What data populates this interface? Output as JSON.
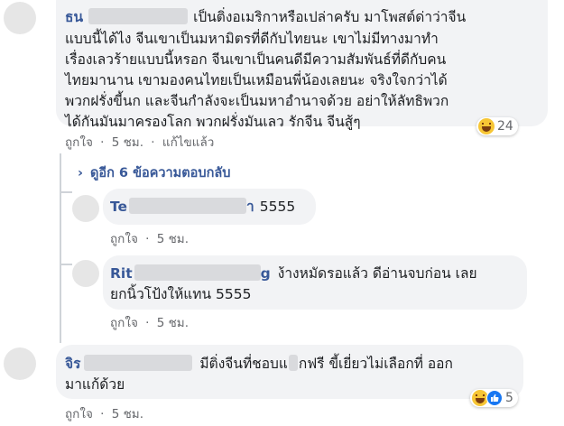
{
  "comment1": {
    "name": "ธน",
    "lines": [
      "เป็นติ่งอเมริกาหรือเปล่าครับ มาโพสต์ด่าว่าจีน",
      "แบบนี้ได้ไง จีนเขาเป็นมหามิตรที่ดีกับไทยนะ เขาไม่มีทางมาทำ",
      "เรื่องเลวร้ายแบบนี้หรอก จีนเขาเป็นคนดีมีความสัมพันธ์ที่ดีกับคน",
      "ไทยมานาน เขามองคนไทยเป็นเหมือนพี่น้องเลยนะ จริงใจกว่าได้",
      "พวกฝรั่งขี้นก และจีนกำลังจะเป็นมหาอำนาจด้วย อย่าให้ลัทธิพวก",
      "ได้กันมันมาครองโลก พวกฝรั่งมันเลว รักจีน จีนสู้ๆ"
    ],
    "like": "ถูกใจ",
    "time": "5 ชม.",
    "edited": "แก้ไขแล้ว",
    "reaction_count": "24"
  },
  "replies_link": "ดูอีก 6 ข้อความตอบกลับ",
  "reply1": {
    "name": "Te",
    "name_end": "า",
    "text": "5555",
    "like": "ถูกใจ",
    "time": "5 ชม."
  },
  "reply2": {
    "name": "Rit",
    "name_end": "g",
    "line1": "ง้างหมัดรอแล้ว ดีอ่านจบก่อน เลย",
    "line2": "ยกนิ้วโป้งให้แทน 5555",
    "like": "ถูกใจ",
    "time": "5 ชม."
  },
  "comment2": {
    "name": "จิร",
    "line1a": "มีติ่งจีนที่ชอบแ",
    "line1b": "กฟรี ขี้เยี่ยวไม่เลือกที่ ออก",
    "line2": "มาแก้ด้วย",
    "like": "ถูกใจ",
    "time": "5 ชม.",
    "reaction_count": "5"
  },
  "separator": "·",
  "icons": [
    "chevron-right-icon",
    "haha-reaction-icon",
    "like-reaction-icon"
  ]
}
